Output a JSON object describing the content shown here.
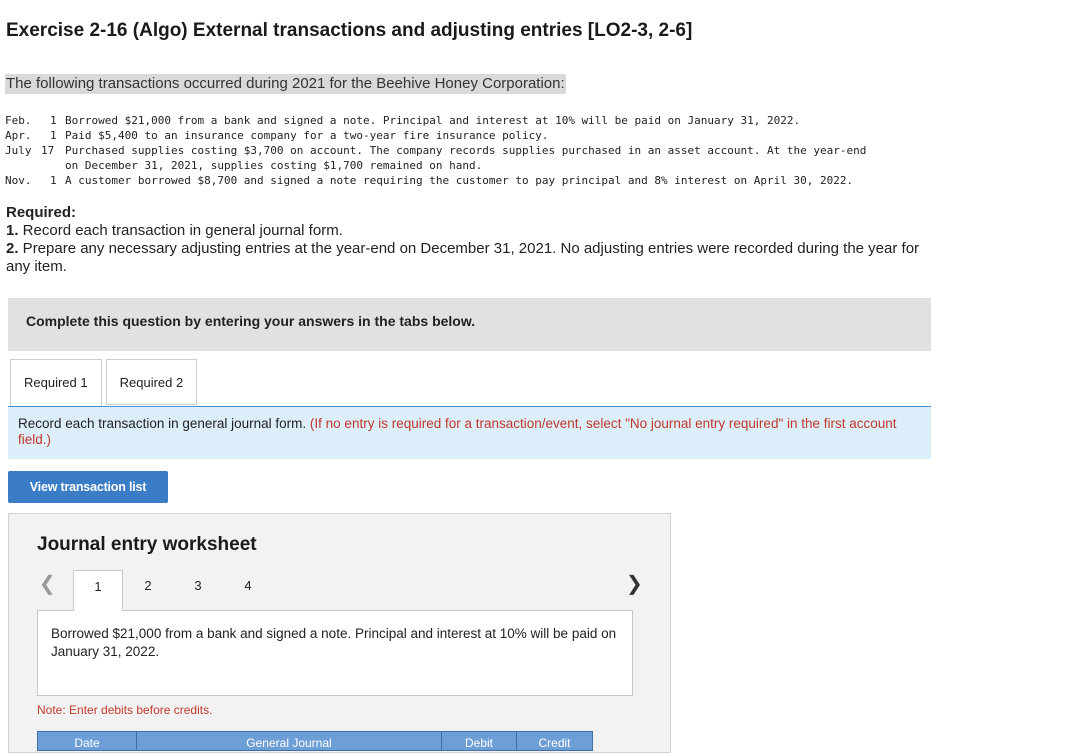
{
  "title": "Exercise 2-16 (Algo) External transactions and adjusting entries [LO2-3, 2-6]",
  "intro": "The following transactions occurred during 2021 for the Beehive Honey Corporation:",
  "transactions": [
    {
      "month": "Feb.",
      "day": "1",
      "text": "Borrowed $21,000 from a bank and signed a note. Principal and interest at 10% will be paid on January 31, 2022."
    },
    {
      "month": "Apr.",
      "day": "1",
      "text": "Paid $5,400 to an insurance company for a two-year fire insurance policy."
    },
    {
      "month": "July",
      "day": "17",
      "text": "Purchased supplies costing $3,700 on account. The company records supplies purchased in an asset account. At the year-end\non December 31, 2021, supplies costing $1,700 remained on hand."
    },
    {
      "month": "Nov.",
      "day": "1",
      "text": "A customer borrowed $8,700 and signed a note requiring the customer to pay principal and 8% interest on April 30, 2022."
    }
  ],
  "required": {
    "heading": "Required:",
    "item1_num": "1.",
    "item1_text": " Record each transaction in general journal form.",
    "item2_num": "2.",
    "item2_text": " Prepare any necessary adjusting entries at the year-end on December 31, 2021. No adjusting entries were recorded during the year for any item."
  },
  "banner": "Complete this question by entering your answers in the tabs below.",
  "tabs": [
    {
      "label": "Required 1",
      "active": true
    },
    {
      "label": "Required 2",
      "active": false
    }
  ],
  "instruction": {
    "text": "Record each transaction in general journal form.",
    "hint": "(If no entry is required for a transaction/event, select \"No journal entry required\" in the first account field.)"
  },
  "view_button": "View transaction list",
  "worksheet": {
    "title": "Journal entry worksheet",
    "steps": [
      "1",
      "2",
      "3",
      "4"
    ],
    "active_step": "1",
    "description": "Borrowed $21,000 from a bank and signed a note. Principal and interest at 10% will be paid on January 31, 2022.",
    "note": "Note: Enter debits before credits.",
    "columns": [
      "Date",
      "General Journal",
      "Debit",
      "Credit"
    ]
  },
  "icons": {
    "prev": "chevron-left-icon",
    "next": "chevron-right-icon"
  },
  "colors": {
    "accent": "#3a7cc6",
    "hint_red": "#c0392b",
    "instruction_bg": "#dceef9",
    "table_header": "#6d9fd6"
  }
}
